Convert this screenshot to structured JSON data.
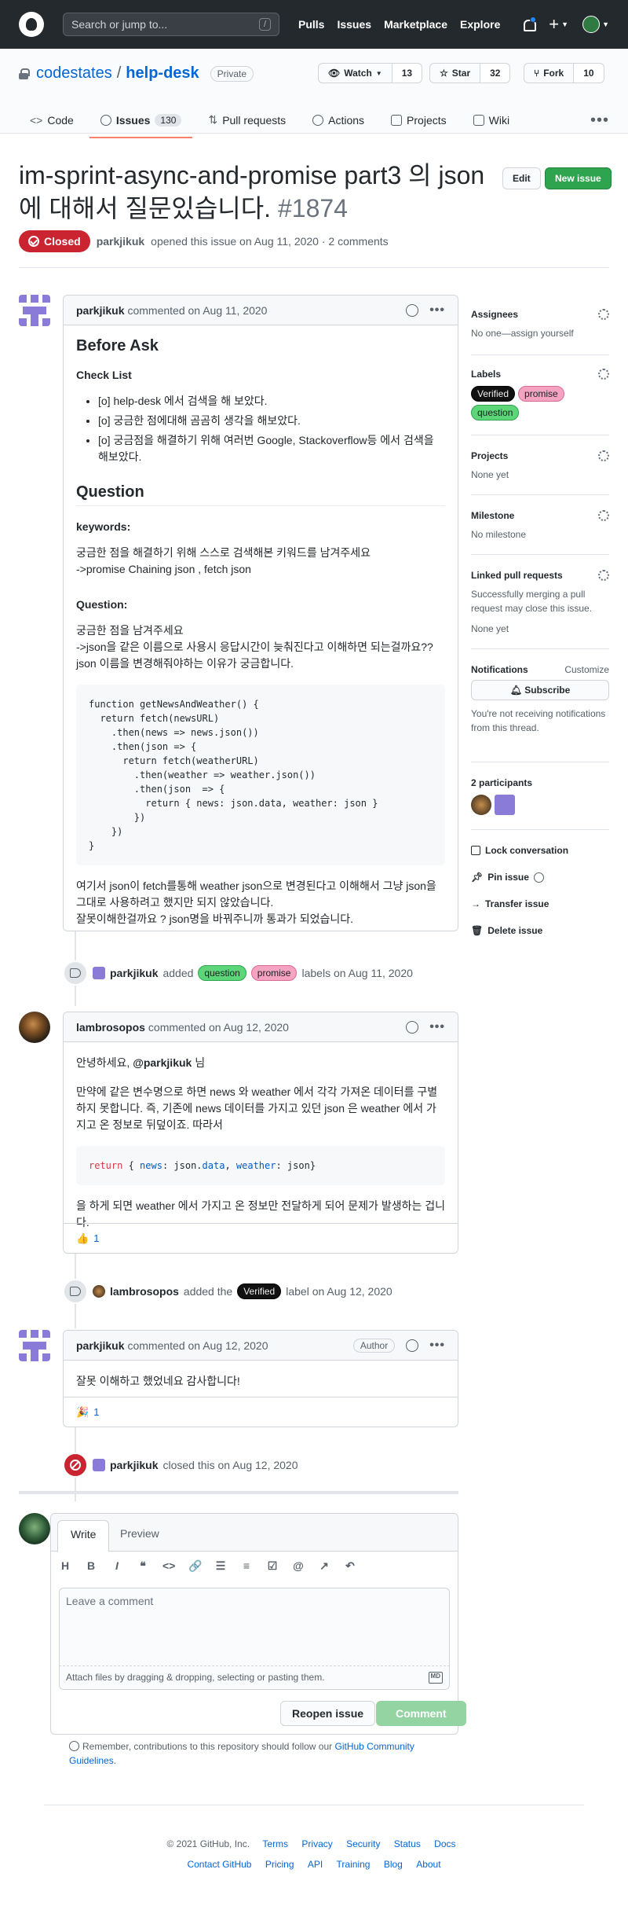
{
  "topbar": {
    "search_placeholder": "Search or jump to...",
    "slash": "/",
    "nav": [
      "Pulls",
      "Issues",
      "Marketplace",
      "Explore"
    ]
  },
  "repo": {
    "owner": "codestates",
    "sep": "/",
    "name": "help-desk",
    "visibility": "Private",
    "watch_label": "Watch",
    "watch_count": "13",
    "star_label": "Star",
    "star_count": "32",
    "fork_label": "Fork",
    "fork_count": "10",
    "tabs": [
      {
        "label": "Code"
      },
      {
        "label": "Issues",
        "count": "130"
      },
      {
        "label": "Pull requests"
      },
      {
        "label": "Actions"
      },
      {
        "label": "Projects"
      },
      {
        "label": "Wiki"
      }
    ]
  },
  "issue": {
    "title": "im-sprint-async-and-promise part3 의 json에 대해서 질문있습니다.",
    "number": "#1874",
    "edit_label": "Edit",
    "new_label": "New issue",
    "state": "Closed",
    "author": "parkjikuk",
    "meta": "opened this issue on Aug 11, 2020 · 2 comments"
  },
  "comment1": {
    "author": "parkjikuk",
    "meta": "commented on Aug 11, 2020",
    "h_before": "Before Ask",
    "h_check": "Check List",
    "checklist": [
      "[o] help-desk 에서 검색을 해 보았다.",
      "[o] 궁금한 점에대해 곰곰히 생각을 해보았다.",
      "[o] 궁금점을 해결하기 위해 여러번 Google, Stackoverflow등 에서 검색을 해보았다."
    ],
    "h_question": "Question",
    "h_keywords": "keywords:",
    "kw_line1": "궁금한 점을 해결하기 위해 스스로 검색해본 키워드를 남겨주세요",
    "kw_line2": "->promise Chaining json , fetch json",
    "h_question2": "Question:",
    "q_line1": "궁금한 점을 남겨주세요",
    "q_line2": "->json을 같은 이름으로 사용시 응답시간이 늦춰진다고 이해하면 되는걸까요?? json 이름을 변경해줘야하는 이유가 궁금합니다.",
    "code": "function getNewsAndWeather() {\n  return fetch(newsURL)\n    .then(news => news.json())\n    .then(json => {\n      return fetch(weatherURL)\n        .then(weather => weather.json())\n        .then(json  => {\n          return { news: json.data, weather: json }\n        })\n    })\n}",
    "p_line1": "여기서 json이 fetch를통해 weather json으로 변경된다고 이해해서 그냥 json을 그대로 사용하려고 했지만 되지 않았습니다.",
    "p_line2": "잘못이해한걸까요 ? json명을 바꿔주니까 통과가 되었습니다."
  },
  "event_labels": {
    "actor": "parkjikuk",
    "verb": "added",
    "labels": [
      "question",
      "promise"
    ],
    "tail": "labels on Aug 11, 2020"
  },
  "comment2": {
    "author": "lambrosopos",
    "meta": "commented on Aug 12, 2020",
    "greet_pre": "안녕하세요,",
    "mention": "@parkjikuk",
    "greet_post": "님",
    "p1": "만약에 같은 변수명으로 하면 news 와 weather 에서 각각 가져온 데이터를 구별하지 못합니다. 즉, 기존에 news 데이터를 가지고 있던 json 은 weather 에서 가지고 온 정보로 뒤덮이죠. 따라서",
    "code_kw": "return",
    "code_a": " { ",
    "code_b": "news",
    "code_c": ": json.",
    "code_d": "data",
    "code_e": ", ",
    "code_f": "weather",
    "code_g": ": json}",
    "p2": "을 하게 되면 weather 에서 가지고 온 정보만 전달하게 되어 문제가 발생하는 겁니다.",
    "reaction_emoji": "👍",
    "reaction_count": "1"
  },
  "event_verified": {
    "actor": "lambrosopos",
    "verb": "added the",
    "label": "Verified",
    "tail": "label on Aug 12, 2020"
  },
  "comment3": {
    "author": "parkjikuk",
    "meta": "commented on Aug 12, 2020",
    "badge": "Author",
    "body": "잘못 이해하고 했었네요 감사합니다!",
    "reaction_emoji": "🎉",
    "reaction_count": "1"
  },
  "event_closed": {
    "actor": "parkjikuk",
    "tail": "closed this on Aug 12, 2020"
  },
  "composer": {
    "tab_write": "Write",
    "tab_preview": "Preview",
    "toolbar": [
      "H",
      "B",
      "I",
      "❝",
      "<>",
      "🔗",
      "☰",
      "≡",
      "☑",
      "@",
      "↗",
      "↶"
    ],
    "placeholder": "Leave a comment",
    "attach": "Attach files by dragging & dropping, selecting or pasting them.",
    "md": "MD",
    "reopen": "Reopen issue",
    "submit": "Comment"
  },
  "note": {
    "text": "Remember, contributions to this repository should follow our",
    "link": "GitHub Community Guidelines",
    "end": "."
  },
  "sidebar": {
    "assignees_h": "Assignees",
    "assignees_v": "No one—assign yourself",
    "labels_h": "Labels",
    "labels": [
      "Verified",
      "promise",
      "question"
    ],
    "projects_h": "Projects",
    "projects_v": "None yet",
    "milestone_h": "Milestone",
    "milestone_v": "No milestone",
    "linked_h": "Linked pull requests",
    "linked_desc": "Successfully merging a pull request may close this issue.",
    "linked_v": "None yet",
    "notif_h": "Notifications",
    "customize": "Customize",
    "subscribe": "Subscribe",
    "notif_desc": "You're not receiving notifications from this thread.",
    "participants_h": "2 participants",
    "lock": "Lock conversation",
    "pin": "Pin issue",
    "transfer": "Transfer issue",
    "delete": "Delete issue"
  },
  "footer": {
    "copyright": "© 2021 GitHub, Inc.",
    "row1": [
      "Terms",
      "Privacy",
      "Security",
      "Status",
      "Docs"
    ],
    "row2": [
      "Contact GitHub",
      "Pricing",
      "API",
      "Training",
      "Blog",
      "About"
    ]
  },
  "colors": {
    "closed": "#cb2431",
    "new_issue": "#2ea44f",
    "link": "#0366d6",
    "label_question": "#5dd679",
    "label_promise": "#f5a3c0",
    "label_verified": "#111111"
  }
}
